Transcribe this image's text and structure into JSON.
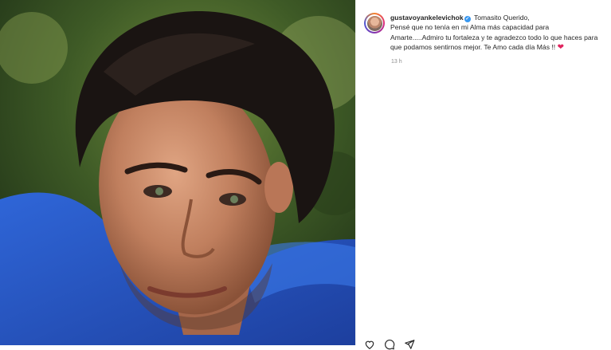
{
  "post": {
    "username": "gustavoyankelevichok",
    "verified": true,
    "caption_title": "Tomasito Querido,",
    "caption_body": "Pensé que no tenía en mi Alma más capacidad para Amarte.....Admiro tu fortaleza y te agradezco todo lo que haces para que podamos sentirnos mejor. Te Amo cada día Más !!",
    "caption_emoji": "❤",
    "timestamp": "13 h"
  },
  "icons": {
    "verified": "verified-badge-icon",
    "like": "heart-icon",
    "comment": "comment-icon",
    "share": "share-icon"
  },
  "colors": {
    "accent_blue": "#3897f0",
    "heart_red": "#e0245e",
    "meta_gray": "#8e8e8e"
  }
}
